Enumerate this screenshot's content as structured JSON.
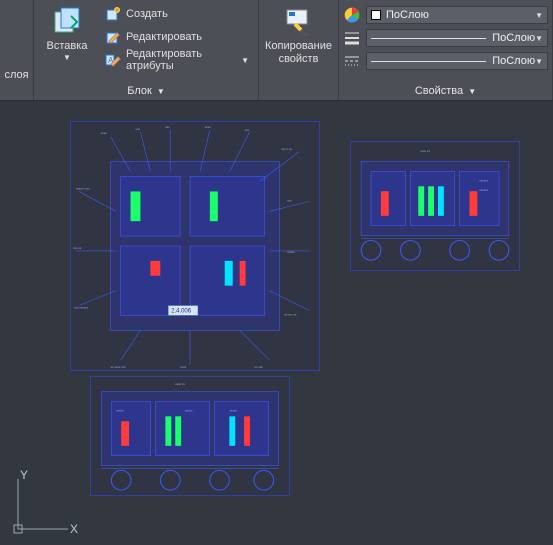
{
  "ribbon": {
    "layer": {
      "label": "слоя"
    },
    "block": {
      "title": "Блок",
      "insert": "Вставка",
      "create": "Создать",
      "edit": "Редактировать",
      "edit_attrs": "Редактировать атрибуты"
    },
    "clip": {
      "title": "",
      "copy_props_line1": "Копирование",
      "copy_props_line2": "свойств"
    },
    "props": {
      "title": "Свойства",
      "color_value": "ПоСлою",
      "lineweight_value": "ПоСлою",
      "linetype_value": "ПоСлою"
    }
  },
  "ucs": {
    "x": "X",
    "y": "Y"
  },
  "cad_label_sample": "2.4.006"
}
